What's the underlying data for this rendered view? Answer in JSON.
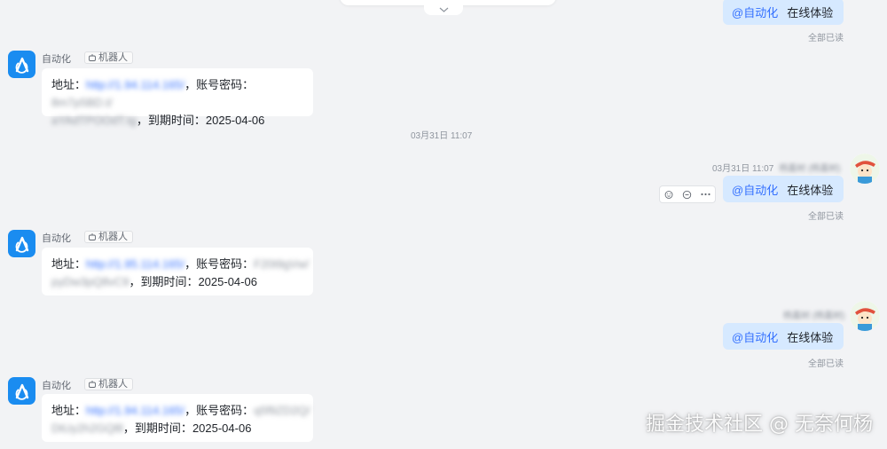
{
  "bot": {
    "name": "自动化",
    "tag": "机器人",
    "labels": {
      "address": "地址：",
      "account": "，账号密码：",
      "expiry_prefix": "，到期时间："
    }
  },
  "messages_bot": [
    {
      "url": "http://1.94.114.165/",
      "cred_line1": "8m7p5BD.t/",
      "cred_line2": "aYAdTPOOdT.tg",
      "expiry": "2025-04-06"
    },
    {
      "url": "http://1.95.114.165/",
      "cred_line1": "F20t9gVw/",
      "cred_line2": "pyDw3pQ8vC9",
      "expiry": "2025-04-06"
    },
    {
      "url": "http://1.94.114.165/",
      "cred_line1": "q5f9ZD2Q/",
      "cred_line2": "DtUy2h2GQ8l",
      "expiry": "2025-04-06"
    }
  ],
  "user_message": {
    "mention": "@自动化",
    "text": "在线体验",
    "read": "全部已读"
  },
  "sender": {
    "name": "杨嘉树 (杨嘉树)",
    "time": "03月31日 11:07"
  },
  "center_time": "03月31日 11:07",
  "watermark": "掘金技术社区 @ 无奈何杨",
  "colors": {
    "accent": "#3370ff",
    "bot_avatar": "#1a8cf0",
    "user_bubble": "#d6e9ff",
    "background": "#f2f3f5"
  },
  "icons": {
    "bot": "robot-icon",
    "read": "check-icon",
    "expand": "chevron-down-icon"
  }
}
